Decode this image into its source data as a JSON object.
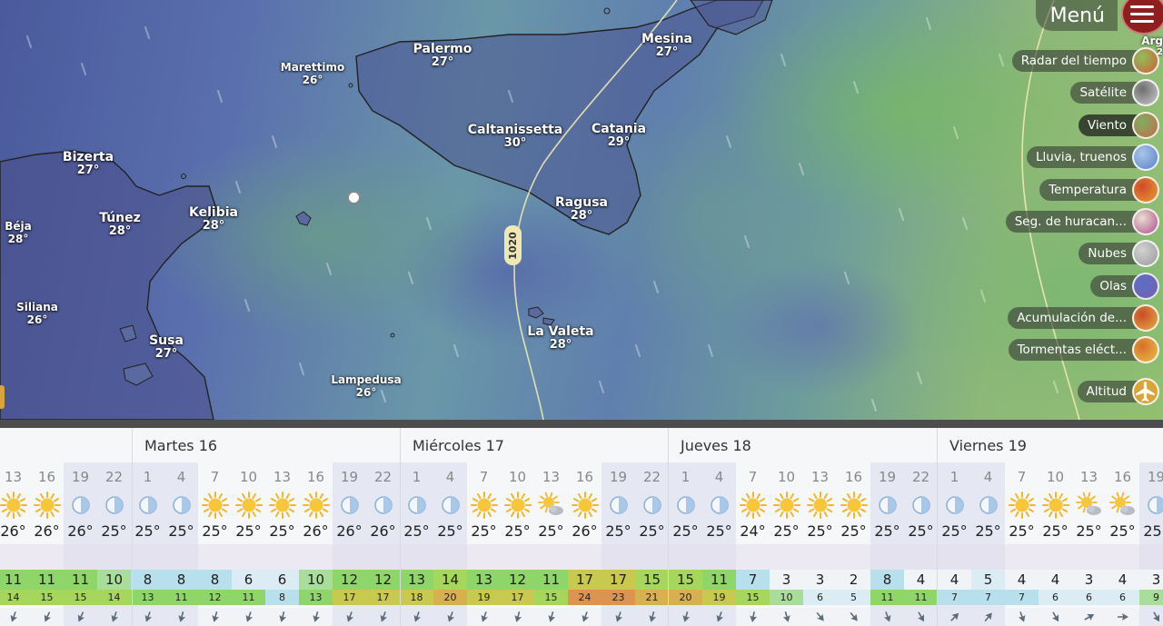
{
  "menu": {
    "label": "Menú",
    "edge_label": "Arg",
    "edge_value": "2"
  },
  "layers": [
    {
      "label": "Radar del tiempo",
      "icon": "radar-thumb-icon",
      "colors": [
        "#d35c3a",
        "#8fbf5a"
      ]
    },
    {
      "label": "Satélite",
      "icon": "satellite-thumb-icon",
      "colors": [
        "#c9c9c9",
        "#6e6e6e"
      ]
    },
    {
      "label": "Viento",
      "icon": "wind-thumb-icon",
      "active": true,
      "colors": [
        "#c76b4a",
        "#7fae62"
      ]
    },
    {
      "label": "Lluvia, truenos",
      "icon": "rain-thumb-icon",
      "colors": [
        "#5b7fc7",
        "#a8c6e8"
      ]
    },
    {
      "label": "Temperatura",
      "icon": "temperature-thumb-icon",
      "colors": [
        "#e6a033",
        "#cf4b2b"
      ]
    },
    {
      "label": "Seg. de huracan...",
      "icon": "hurricane-thumb-icon",
      "colors": [
        "#b04c8f",
        "#e7e0d0"
      ]
    },
    {
      "label": "Nubes",
      "icon": "clouds-thumb-icon",
      "colors": [
        "#9a9a9a",
        "#d2d2d2"
      ]
    },
    {
      "label": "Olas",
      "icon": "waves-thumb-icon",
      "colors": [
        "#7a5fb0",
        "#5b6fc4"
      ]
    },
    {
      "label": "Acumulación de...",
      "icon": "accumulation-thumb-icon",
      "colors": [
        "#e1b045",
        "#c94b2a"
      ]
    },
    {
      "label": "Tormentas eléct...",
      "icon": "thunderstorm-thumb-icon",
      "colors": [
        "#e8c34a",
        "#d66f2c"
      ]
    },
    {
      "label": "Altitud",
      "icon": "airplane-icon",
      "colors": [
        "#d8a43b",
        "#d8a43b"
      ]
    }
  ],
  "cities": [
    {
      "name": "Palermo",
      "temp": "27°"
    },
    {
      "name": "Mesina",
      "temp": "27°"
    },
    {
      "name": "Marettimo",
      "temp": "26°",
      "small": true
    },
    {
      "name": "Caltanissetta",
      "temp": "30°"
    },
    {
      "name": "Catania",
      "temp": "29°"
    },
    {
      "name": "Bizerta",
      "temp": "27°"
    },
    {
      "name": "Túnez",
      "temp": "28°"
    },
    {
      "name": "Kelibia",
      "temp": "28°"
    },
    {
      "name": "Béja",
      "temp": "28°",
      "small": true
    },
    {
      "name": "Ragusa",
      "temp": "28°"
    },
    {
      "name": "Siliana",
      "temp": "26°",
      "small": true
    },
    {
      "name": "Susa",
      "temp": "27°"
    },
    {
      "name": "La Valeta",
      "temp": "28°"
    },
    {
      "name": "Lampedusa",
      "temp": "26°",
      "small": true
    }
  ],
  "isobar_label": "1020",
  "forecast": {
    "days": [
      {
        "label": "Martes 16"
      },
      {
        "label": "Miércoles 17"
      },
      {
        "label": "Jueves 18"
      },
      {
        "label": "Viernes 19"
      }
    ],
    "hours": [
      "13",
      "16",
      "19",
      "22",
      "1",
      "4",
      "7",
      "10",
      "13",
      "16",
      "19",
      "22",
      "1",
      "4",
      "7",
      "10",
      "13",
      "16",
      "19",
      "22",
      "1",
      "4",
      "7",
      "10",
      "13",
      "16",
      "19",
      "22",
      "1",
      "4",
      "7",
      "10",
      "13",
      "16",
      "19"
    ],
    "icons": [
      "sun",
      "sun",
      "moon",
      "moon",
      "moon",
      "moon",
      "sun",
      "sun",
      "sun",
      "sun",
      "moon",
      "moon",
      "moon",
      "moon",
      "sun",
      "sun",
      "partly",
      "sun",
      "moon",
      "moon",
      "moon",
      "moon",
      "sun",
      "sun",
      "sun",
      "sun",
      "moon",
      "moon",
      "moon",
      "moon",
      "sun",
      "sun",
      "partly",
      "partly",
      "moon"
    ],
    "temps": [
      "26°",
      "26°",
      "26°",
      "25°",
      "25°",
      "25°",
      "25°",
      "25°",
      "25°",
      "26°",
      "26°",
      "26°",
      "25°",
      "25°",
      "25°",
      "25°",
      "25°",
      "26°",
      "25°",
      "25°",
      "25°",
      "25°",
      "24°",
      "25°",
      "25°",
      "25°",
      "25°",
      "25°",
      "25°",
      "25°",
      "25°",
      "25°",
      "25°",
      "25°",
      "25°"
    ],
    "wind": [
      "11",
      "11",
      "11",
      "10",
      "8",
      "8",
      "8",
      "6",
      "6",
      "10",
      "12",
      "12",
      "13",
      "14",
      "13",
      "12",
      "11",
      "17",
      "17",
      "15",
      "15",
      "11",
      "7",
      "3",
      "3",
      "2",
      "8",
      "4",
      "4",
      "5",
      "4",
      "4",
      "3",
      "4",
      "3"
    ],
    "gusts": [
      "14",
      "15",
      "15",
      "14",
      "13",
      "11",
      "12",
      "11",
      "8",
      "13",
      "17",
      "17",
      "18",
      "20",
      "19",
      "17",
      "15",
      "24",
      "23",
      "21",
      "20",
      "19",
      "15",
      "10",
      "6",
      "5",
      "11",
      "11",
      "7",
      "7",
      "7",
      "6",
      "6",
      "6",
      "9"
    ],
    "directions": [
      200,
      205,
      205,
      200,
      200,
      195,
      195,
      200,
      195,
      195,
      200,
      200,
      200,
      200,
      200,
      195,
      195,
      200,
      200,
      195,
      195,
      200,
      190,
      165,
      140,
      140,
      160,
      150,
      45,
      40,
      160,
      150,
      60,
      90,
      150
    ]
  }
}
